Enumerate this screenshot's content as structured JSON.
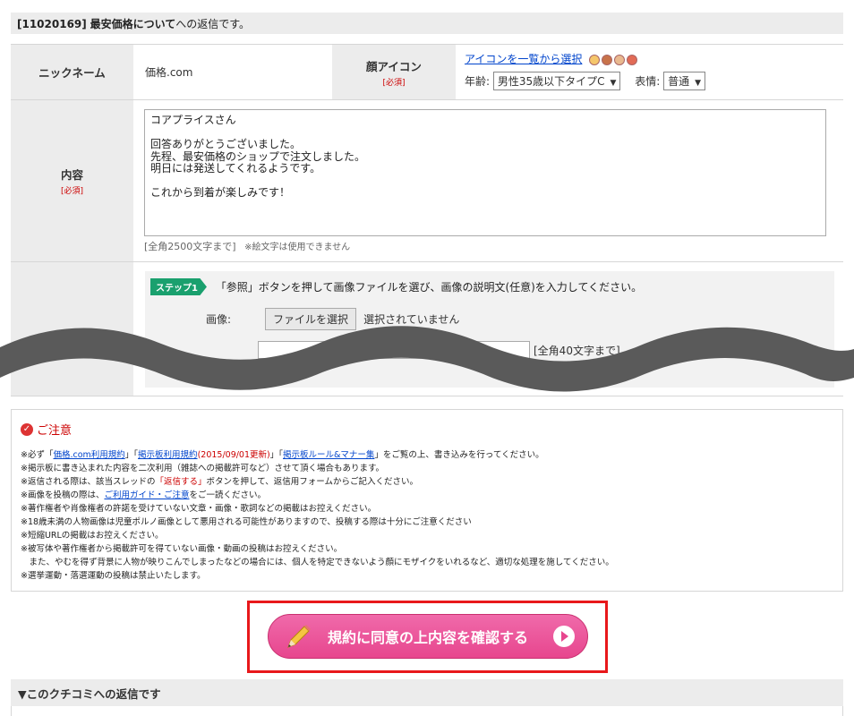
{
  "header": {
    "id": "[11020169]",
    "title": "最安価格について",
    "suffix": "への返信です。"
  },
  "form": {
    "nickname_label": "ニックネーム",
    "nickname_value": "価格.com",
    "face_icon_label": "顔アイコン",
    "required": "[必須]",
    "icon_link": "アイコンを一覧から選択",
    "age_label": "年齢:",
    "age_value": "男性35歳以下タイプC",
    "expression_label": "表情:",
    "expression_value": "普通",
    "content_label": "内容",
    "content_text": "コアプライスさん\n\n回答ありがとうございました。\n先程、最安価格のショップで注文しました。\n明日には発送してくれるようです。\n\nこれから到着が楽しみです！",
    "content_limit": "[全角2500文字まで]",
    "emoji_note": "※絵文字は使用できません",
    "step_badge": "ステップ1",
    "step_text": "「参照」ボタンを押して画像ファイルを選び、画像の説明文(任意)を入力してください。",
    "image_label": "画像:",
    "file_button": "ファイルを選択",
    "file_status": "選択されていません",
    "desc_limit": "[全角40文字まで]"
  },
  "notice": {
    "title": "ご注意",
    "lines": [
      {
        "pre": "※必ず「",
        "l1": "価格.com利用規約",
        "m1": "」「",
        "l2": "掲示板利用規約",
        "red": "(2015/09/01更新)",
        "m2": "」「",
        "l3": "掲示板ルール&マナー集",
        "post": "」をご覧の上、書き込みを行ってください。"
      },
      "※掲示板に書き込まれた内容を二次利用（雑誌への掲載許可など）させて頂く場合もあります。",
      {
        "pre": "※返信される際は、該当スレッドの",
        "red": "「返信する」",
        "post": "ボタンを押して、返信用フォームからご記入ください。"
      },
      {
        "pre": "※画像を投稿の際は、",
        "link": "ご利用ガイド・ご注意",
        "post": "をご一読ください。"
      },
      "※著作権者や肖像権者の許諾を受けていない文章・画像・歌詞などの掲載はお控えください。",
      "※18歳未満の人物画像は児童ポルノ画像として悪用される可能性がありますので、投稿する際は十分にご注意ください",
      "※短縮URLの掲載はお控えください。",
      "※被写体や著作権者から掲載許可を得ていない画像・動画の投稿はお控えください。",
      "　また、やむを得ず背景に人物が映りこんでしまったなどの場合には、個人を特定できないよう顔にモザイクをいれるなど、適切な処理を施してください。",
      "※選挙運動・落選運動の投稿は禁止いたします。"
    ]
  },
  "cta": {
    "label": "規約に同意の上内容を確認する"
  },
  "reply": {
    "heading": "▼このクチコミへの返信です"
  },
  "colors": {
    "accent": "#e7468e",
    "highlight": "#e8181b",
    "step": "#1aa06e"
  }
}
